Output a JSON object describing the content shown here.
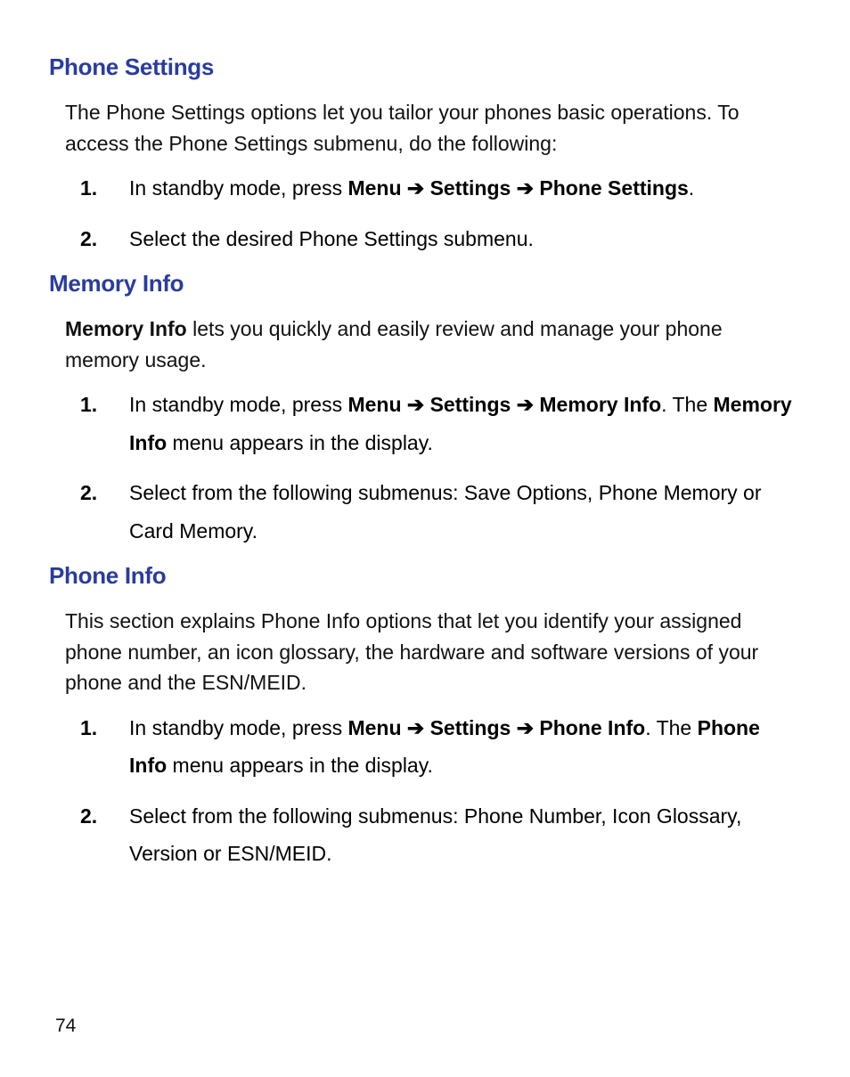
{
  "sections": {
    "phoneSettings": {
      "heading": "Phone Settings",
      "intro": "The Phone Settings options let you tailor your phones basic operations. To access the Phone Settings submenu, do the following:",
      "steps": {
        "s1": {
          "num": "1.",
          "prefix": "In standby mode, press ",
          "menu": "Menu",
          "settings": "Settings",
          "target": "Phone Settings",
          "suffix": "."
        },
        "s2": {
          "num": "2.",
          "text": "Select the desired Phone Settings submenu."
        }
      }
    },
    "memoryInfo": {
      "heading": "Memory Info",
      "introBold": "Memory Info",
      "introRest": " lets you quickly and easily review and manage your phone memory usage.",
      "steps": {
        "s1": {
          "num": "1.",
          "prefix": "In standby mode, press ",
          "menu": "Menu",
          "settings": "Settings",
          "target": "Memory Info",
          "after1": ". The ",
          "bold2": "Memory Info",
          "after2": " menu appears in the display."
        },
        "s2": {
          "num": "2.",
          "text": "Select from the following submenus: Save Options, Phone Memory or Card Memory."
        }
      }
    },
    "phoneInfo": {
      "heading": "Phone Info",
      "intro": "This section explains Phone Info options that let you identify your assigned phone number, an icon glossary, the hardware and software versions of your phone and the ESN/MEID.",
      "steps": {
        "s1": {
          "num": "1.",
          "prefix": "In standby mode, press ",
          "menu": "Menu",
          "settings": "Settings",
          "target": "Phone Info",
          "after1": ". The ",
          "bold2": "Phone Info",
          "after2": " menu appears in the display."
        },
        "s2": {
          "num": "2.",
          "text": "Select from the following submenus: Phone Number, Icon Glossary, Version or ESN/MEID."
        }
      }
    }
  },
  "arrow": " ➔ ",
  "pageNumber": "74"
}
